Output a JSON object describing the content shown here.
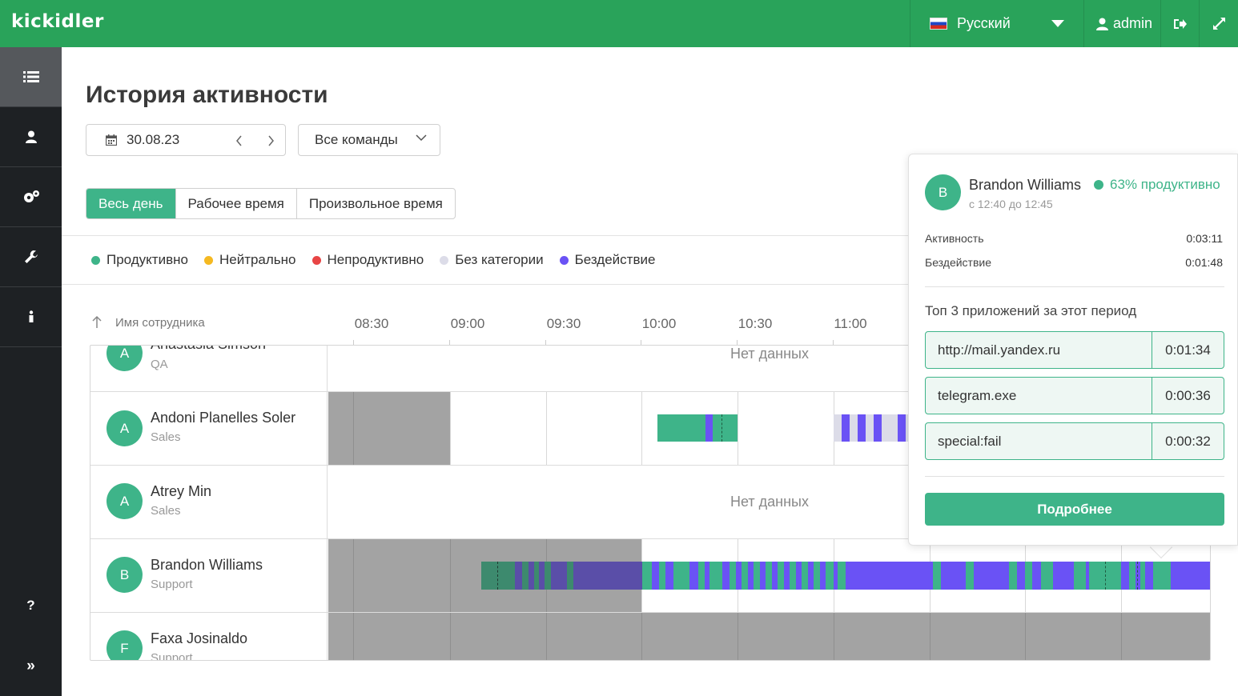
{
  "header": {
    "logo": "kickidler",
    "language": "Русский",
    "user": "admin"
  },
  "sidebar": {
    "items": [
      {
        "icon": "list-icon",
        "active": true
      },
      {
        "icon": "user-icon"
      },
      {
        "icon": "gears-icon"
      },
      {
        "icon": "wrench-icon"
      },
      {
        "icon": "info-icon"
      }
    ],
    "help": "?",
    "collapse": "»"
  },
  "page": {
    "title": "История активности",
    "date": "30.08.23",
    "team_filter": "Все команды"
  },
  "period_tabs": [
    "Весь день",
    "Рабочее время",
    "Произвольное время"
  ],
  "legend": [
    {
      "label": "Продуктивно",
      "color": "#3eb489"
    },
    {
      "label": "Нейтрально",
      "color": "#f5b921"
    },
    {
      "label": "Непродуктивно",
      "color": "#e84545"
    },
    {
      "label": "Без категории",
      "color": "#dcdce8"
    },
    {
      "label": "Бездействие",
      "color": "#6a52f5"
    }
  ],
  "table": {
    "name_header": "Имя сотрудника",
    "times": [
      "08:30",
      "09:00",
      "09:30",
      "10:00",
      "10:30",
      "11:00"
    ],
    "no_data": "Нет данных",
    "rows": [
      {
        "initial": "A",
        "name": "Anastasia Simson",
        "team": "QA"
      },
      {
        "initial": "A",
        "name": "Andoni Planelles Soler",
        "team": "Sales"
      },
      {
        "initial": "A",
        "name": "Atrey Min",
        "team": "Sales"
      },
      {
        "initial": "B",
        "name": "Brandon Williams",
        "team": "Support"
      },
      {
        "initial": "F",
        "name": "Faxa Josinaldo",
        "team": "Support"
      }
    ]
  },
  "popover": {
    "initial": "B",
    "name": "Brandon Williams",
    "productivity": "63% продуктивно",
    "range": "с 12:40 до 12:45",
    "activity_label": "Активность",
    "activity_value": "0:03:11",
    "idle_label": "Бездействие",
    "idle_value": "0:01:48",
    "top_title": "Топ 3 приложений за этот период",
    "apps": [
      {
        "name": "http://mail.yandex.ru",
        "time": "0:01:34"
      },
      {
        "name": "telegram.exe",
        "time": "0:00:36"
      },
      {
        "name": "special:fail",
        "time": "0:00:32"
      }
    ],
    "more_button": "Подробнее"
  }
}
